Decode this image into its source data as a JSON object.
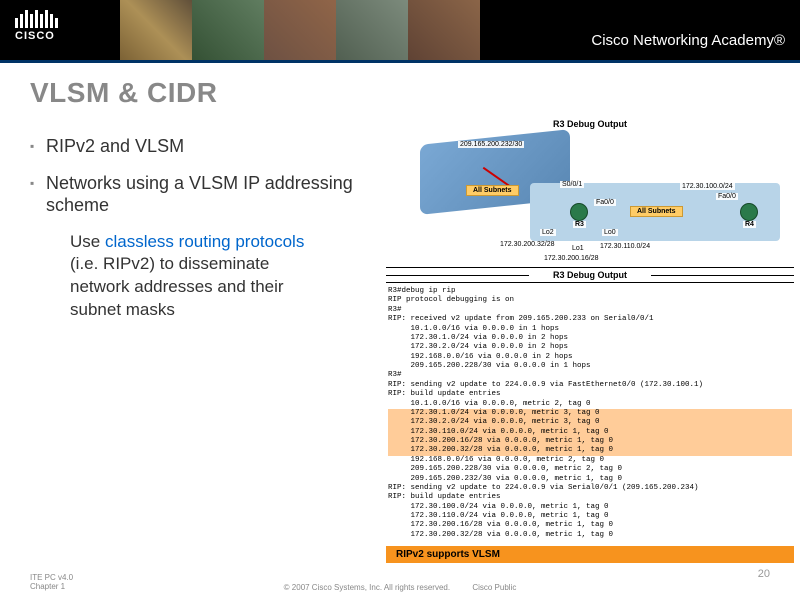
{
  "header": {
    "brand": "CISCO",
    "academy": "Cisco Networking Academy®"
  },
  "title": "VLSM & CIDR",
  "bullets": {
    "b1": "RIPv2 and VLSM",
    "b2": "Networks using a VLSM IP addressing scheme"
  },
  "sub": {
    "pre": "Use ",
    "link": "classless routing protocols",
    "post": " (i.e. RIPv2) to disseminate network addresses and their subnet masks"
  },
  "diagram": {
    "title": "R3 Debug Output",
    "wan": "209.165.200.232/30",
    "sub_badge": "All Subnets",
    "s001": "S0/0/1",
    "fa00a": "Fa0/0",
    "fa00b": "Fa0/0",
    "r3": "R3",
    "r4": "R4",
    "lo0": "Lo0",
    "lo1": "Lo1",
    "lo2": "Lo2",
    "n1": "172.30.100.0/24",
    "n2": "172.30.200.32/28",
    "n3": "172.30.200.16/28",
    "n4": "172.30.110.0/24"
  },
  "term": {
    "head": "R3 Debug Output",
    "l1": "R3#debug ip rip",
    "l2": "RIP protocol debugging is on",
    "l3": "R3#",
    "l4": "RIP: received v2 update from 209.165.200.233 on Serial0/0/1",
    "l5": "     10.1.0.0/16 via 0.0.0.0 in 1 hops",
    "l6": "     172.30.1.0/24 via 0.0.0.0 in 2 hops",
    "l7": "     172.30.2.0/24 via 0.0.0.0 in 2 hops",
    "l8": "     192.168.0.0/16 via 0.0.0.0 in 2 hops",
    "l9": "     209.165.200.228/30 via 0.0.0.0 in 1 hops",
    "l10": "R3#",
    "l11": "RIP: sending v2 update to 224.0.0.9 via FastEthernet0/0 (172.30.100.1)",
    "l12": "RIP: build update entries",
    "l13": "     10.1.0.0/16 via 0.0.0.0, metric 2, tag 0",
    "h1": "     172.30.1.0/24 via 0.0.0.0, metric 3, tag 0",
    "h2": "     172.30.2.0/24 via 0.0.0.0, metric 3, tag 0",
    "h3": "     172.30.110.0/24 via 0.0.0.0, metric 1, tag 0",
    "h4": "     172.30.200.16/28 via 0.0.0.0, metric 1, tag 0",
    "h5": "     172.30.200.32/28 via 0.0.0.0, metric 1, tag 0",
    "l14": "     192.168.0.0/16 via 0.0.0.0, metric 2, tag 0",
    "l15": "     209.165.200.228/30 via 0.0.0.0, metric 2, tag 0",
    "l16": "     209.165.200.232/30 via 0.0.0.0, metric 1, tag 0",
    "l17": "RIP: sending v2 update to 224.0.0.9 via Serial0/0/1 (209.165.200.234)",
    "l18": "RIP: build update entries",
    "l19": "     172.30.100.0/24 via 0.0.0.0, metric 1, tag 0",
    "l20": "     172.30.110.0/24 via 0.0.0.0, metric 1, tag 0",
    "l21": "     172.30.200.16/28 via 0.0.0.0, metric 1, tag 0",
    "l22": "     172.30.200.32/28 via 0.0.0.0, metric 1, tag 0",
    "tag": "RIPv2 supports VLSM"
  },
  "footer": {
    "left1": "ITE PC v4.0",
    "left2": "Chapter 1",
    "copy": "© 2007 Cisco Systems, Inc. All rights reserved.",
    "pub": "Cisco Public",
    "page": "20"
  }
}
